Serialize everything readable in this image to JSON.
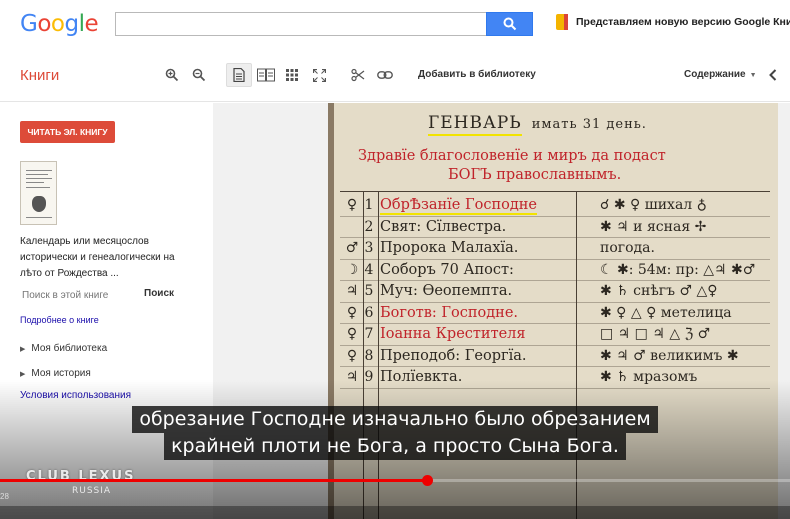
{
  "header": {
    "logo_letters": [
      {
        "ch": "G",
        "color": "#4285f4"
      },
      {
        "ch": "o",
        "color": "#ea4335"
      },
      {
        "ch": "o",
        "color": "#fbbc05"
      },
      {
        "ch": "g",
        "color": "#4285f4"
      },
      {
        "ch": "l",
        "color": "#34a853"
      },
      {
        "ch": "e",
        "color": "#ea4335"
      }
    ],
    "search_value": "",
    "search_icon": "search-icon",
    "promo_text": "Представляем новую версию Google Книг!"
  },
  "toolbar": {
    "title": "Книги",
    "icons": [
      "zoom-in-icon",
      "zoom-out-icon",
      "single-page-icon",
      "two-page-icon",
      "grid-view-icon",
      "fullscreen-icon",
      "clip-icon",
      "link-icon"
    ],
    "add_to_library": "Добавить в библиотеку",
    "contents_label": "Содержание"
  },
  "sidebar": {
    "read_button": "ЧИТАТЬ ЭЛ. КНИГУ",
    "book_title": "Календарь или месяцослов исторически и генеалогически на лѣто от Рождества ...",
    "search_placeholder": "Поиск в этой книге",
    "search_button": "Поиск",
    "about_link": "Подробнее о книге",
    "nav": [
      {
        "label": "Моя библиотека"
      },
      {
        "label": "Моя история"
      }
    ],
    "terms_link": "Условия использования"
  },
  "page": {
    "month": "ГЕНВАРЬ",
    "month_suffix": "имать 31 день.",
    "greeting_1": "Здравїе благословенїе и миръ да подаст",
    "greeting_2": "БОГЪ православнымъ.",
    "rows": [
      {
        "sym": "♀",
        "num": "1",
        "text": "ОбрѢзанїе Господне",
        "red": true,
        "right": "☌ ✱ ♀   шихал  ♁"
      },
      {
        "sym": "",
        "num": "2",
        "text": "Свят: Сїлвестра.",
        "red": false,
        "right": "✱ ♃     и ясная  ✢"
      },
      {
        "sym": "♂",
        "num": "3",
        "text": "Пророка Малахїа.",
        "red": false,
        "right": "        погода."
      },
      {
        "sym": "☽",
        "num": "4",
        "text": "Соборъ 70 Апост:",
        "red": false,
        "right": "☾ ✱: 54м: пр: △♃ ✱♂"
      },
      {
        "sym": "♃",
        "num": "5",
        "text": "Муч: Ѳеопемпта.",
        "red": false,
        "right": "✱ ♄    снѣгъ  ♂ △♀"
      },
      {
        "sym": "♀",
        "num": "6",
        "text": "Боготв: Господне.",
        "red": true,
        "right": "✱ ♀ △ ♀ метелица"
      },
      {
        "sym": "♀",
        "num": "7",
        "text": "Іоанна Крестителя",
        "red": true,
        "right": "□ ♃ □ ♃ △ ℨ  ♂"
      },
      {
        "sym": "♀",
        "num": "8",
        "text": "Преподоб: Георгїа.",
        "red": false,
        "right": "✱ ♃ ♂  великимъ ✱"
      },
      {
        "sym": "♃",
        "num": "9",
        "text": "Полїевкта.",
        "red": false,
        "right": "✱ ♄      мразомъ"
      }
    ]
  },
  "video": {
    "caption_line_1": "обрезание Господне изначально было обрезанием",
    "caption_line_2": "крайней плоти не Бога, а просто Сына Бога.",
    "watermark": "CLUB LEXUS",
    "watermark_sub": "RUSSIA",
    "progress_fraction": 0.54,
    "timecode": "28"
  }
}
